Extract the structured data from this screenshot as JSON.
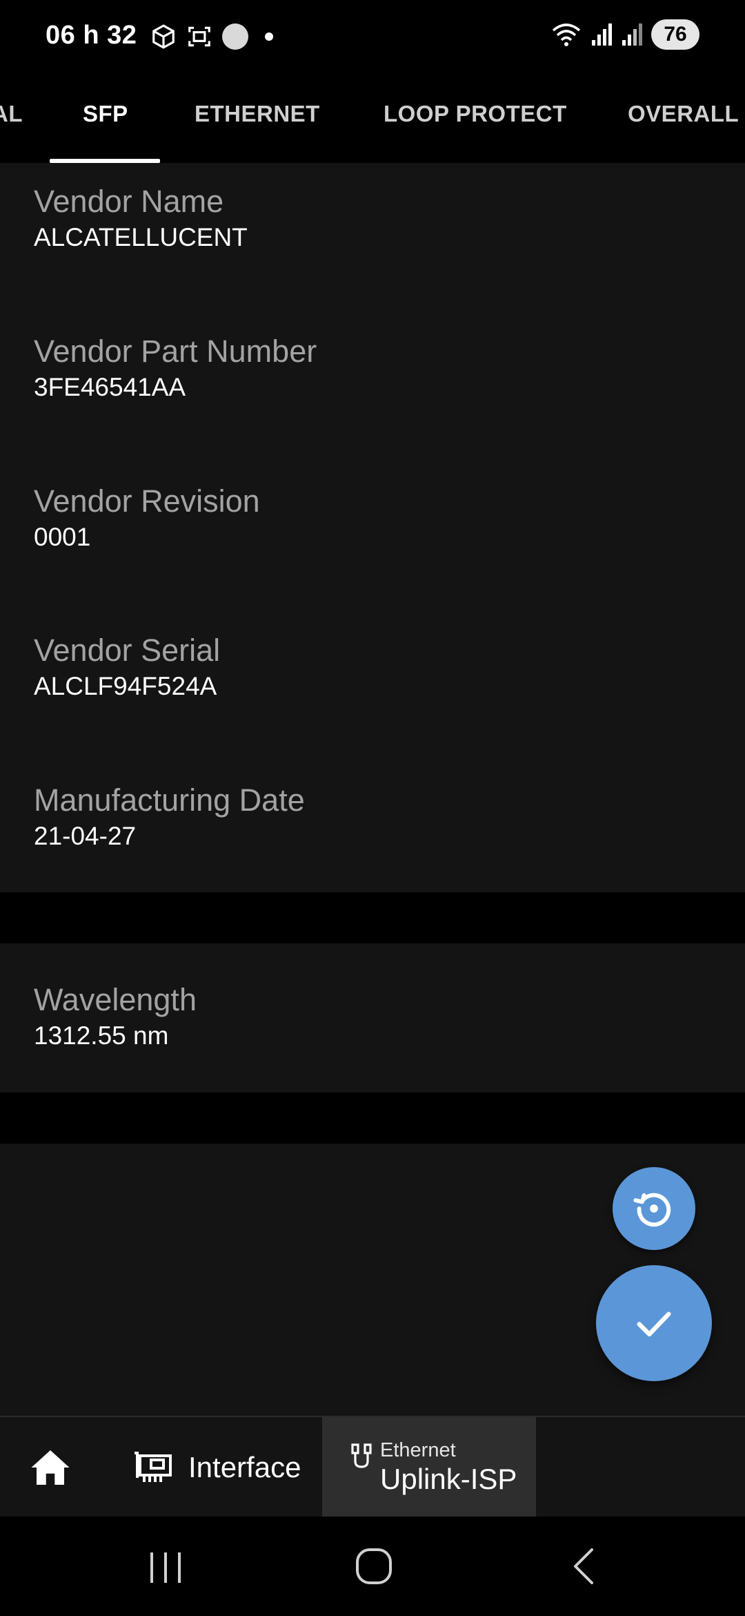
{
  "status_bar": {
    "time": "06 h 32",
    "battery": "76"
  },
  "tabs": [
    {
      "label": "AL"
    },
    {
      "label": "SFP"
    },
    {
      "label": "ETHERNET"
    },
    {
      "label": "LOOP PROTECT"
    },
    {
      "label": "OVERALL S"
    }
  ],
  "fields": {
    "vendor_name": {
      "label": "Vendor Name",
      "value": "ALCATELLUCENT"
    },
    "vendor_part_number": {
      "label": "Vendor Part Number",
      "value": "3FE46541AA"
    },
    "vendor_revision": {
      "label": "Vendor Revision",
      "value": "0001"
    },
    "vendor_serial": {
      "label": "Vendor Serial",
      "value": "ALCLF94F524A"
    },
    "manufacturing_date": {
      "label": "Manufacturing Date",
      "value": "21-04-27"
    },
    "wavelength": {
      "label": "Wavelength",
      "value": "1312.55 nm"
    }
  },
  "breadcrumb": {
    "interface_label": "Interface",
    "ethernet_type": "Ethernet",
    "ethernet_name": "Uplink-ISP"
  },
  "colors": {
    "accent": "#5b97d8",
    "card_background": "#141414",
    "label_text": "#a3a3a3"
  },
  "icons": {
    "fab_secondary": "restore-icon",
    "fab_primary": "check-icon",
    "home": "home-icon",
    "interface": "network-card-icon",
    "ethernet": "ethernet-cable-icon"
  }
}
